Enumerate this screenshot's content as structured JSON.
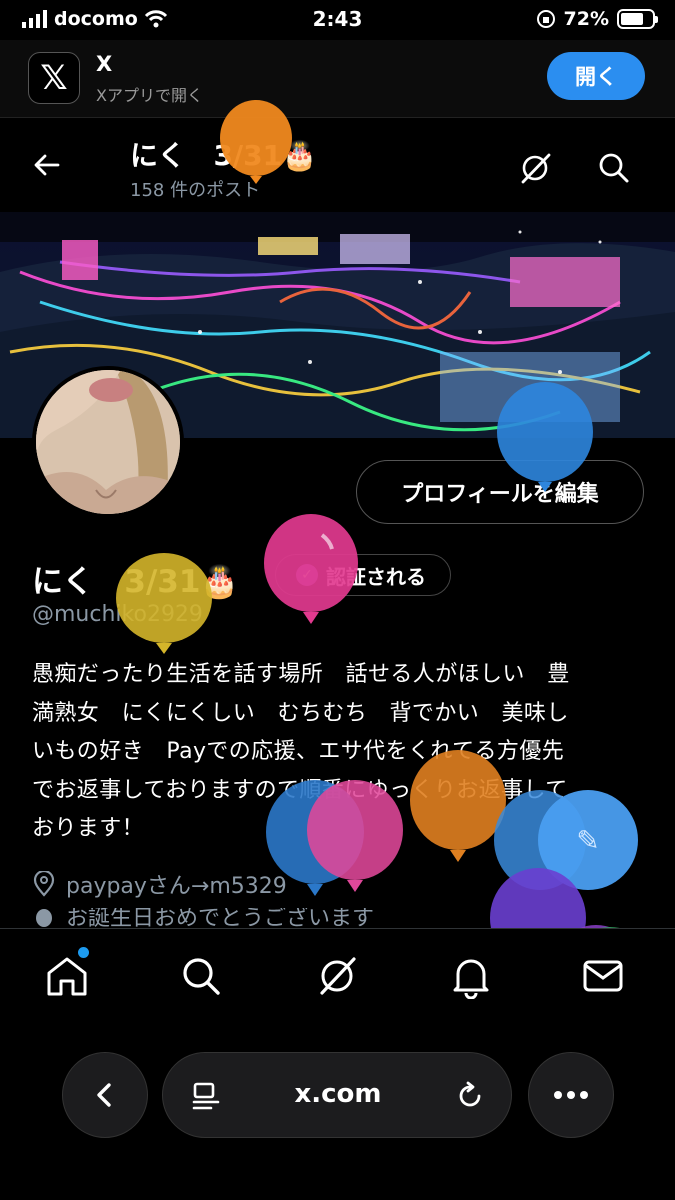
{
  "status_bar": {
    "carrier": "docomo",
    "time": "2:43",
    "battery": "72%",
    "battery_level": 0.72
  },
  "app_banner": {
    "title": "X",
    "subtitle": "Xアプリで開く",
    "open_label": "開く",
    "logo": "𝕏"
  },
  "profile_header": {
    "name": "にく　3/31🎂",
    "post_count": "158 件のポスト"
  },
  "profile": {
    "edit_label": "プロフィールを編集",
    "display_name": "にく　3/31🎂",
    "verify_label": "認証される",
    "handle": "@muchiko2929",
    "bio_lines": [
      "愚痴だったり生活を話す場所　話せる人がほしい　豊",
      "満熟女　にくにくしい　むちむち　背でかい　美味し",
      "いもの好き　Payでの応援、エサ代をくれてる方優先",
      "でお返事しておりますので順番にゆっくりお返事して",
      "おります！"
    ],
    "location": "paypayさん→m5329",
    "birthday_text": "お誕生日おめでとうございます"
  },
  "tab_bar": {
    "items": [
      "home-icon",
      "search-icon",
      "grok-icon",
      "bell-icon",
      "messages-icon"
    ]
  },
  "browser": {
    "url": "x.com"
  },
  "colors": {
    "accent": "#1d9bf0",
    "open_button": "#2b8ef0",
    "verified": "#8f6ad8"
  }
}
